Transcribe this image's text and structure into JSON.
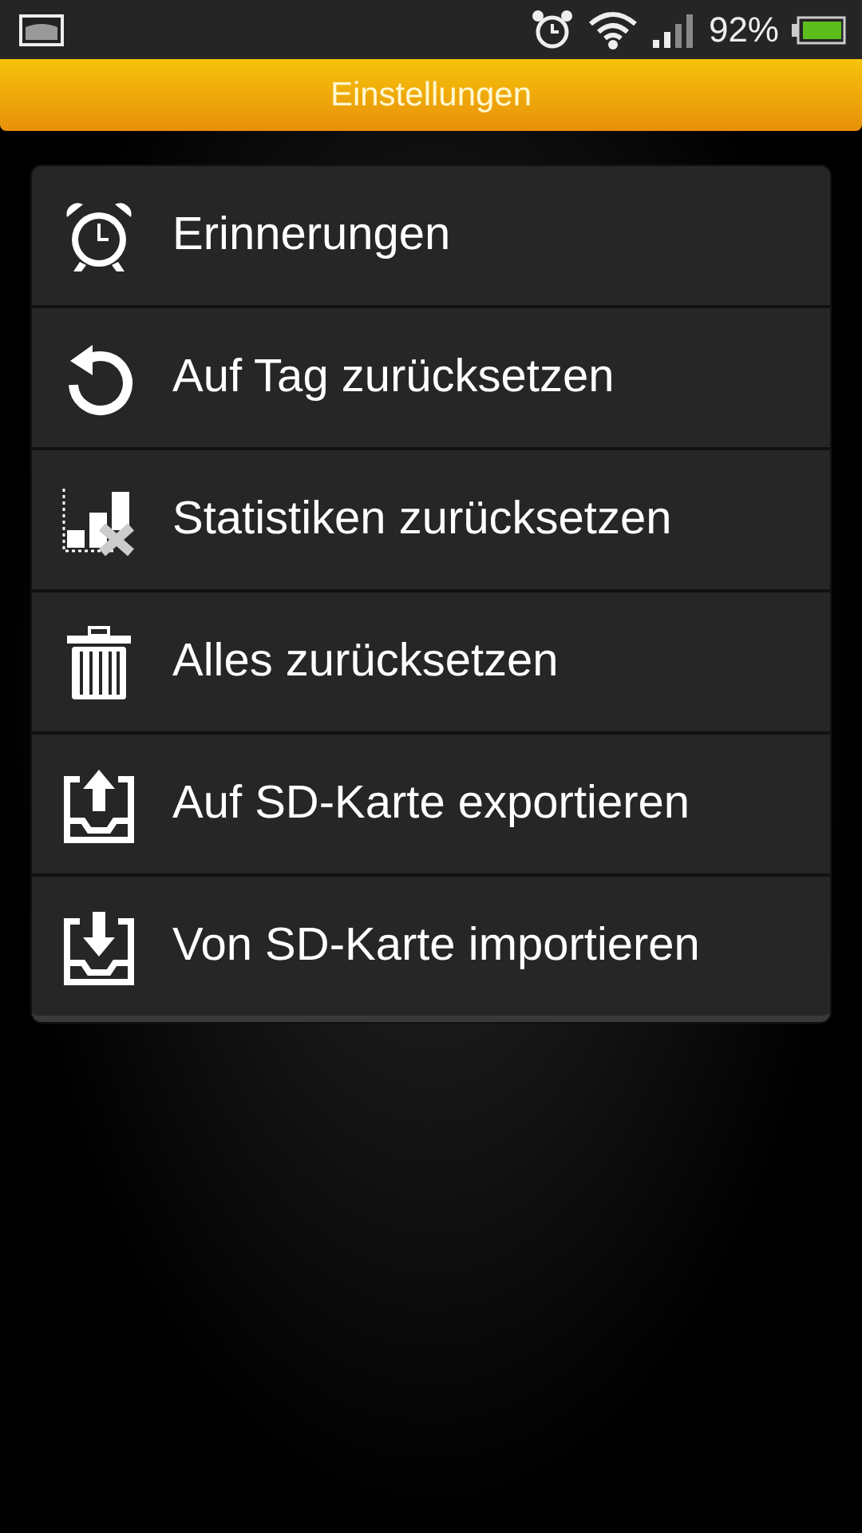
{
  "status_bar": {
    "battery_text": "92%"
  },
  "title_bar": {
    "title": "Einstellungen"
  },
  "menu": [
    {
      "kind": "alarm",
      "label": "Erinnerungen"
    },
    {
      "kind": "undo",
      "label": "Auf Tag zurücksetzen"
    },
    {
      "kind": "stats",
      "label": "Statistiken zurücksetzen"
    },
    {
      "kind": "trash",
      "label": "Alles zurücksetzen"
    },
    {
      "kind": "export",
      "label": "Auf SD-Karte exportieren"
    },
    {
      "kind": "import",
      "label": "Von SD-Karte importieren"
    }
  ]
}
